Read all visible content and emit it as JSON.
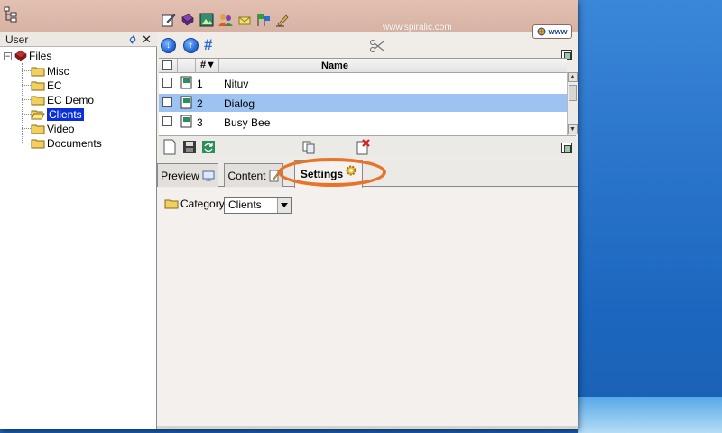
{
  "header": {
    "site_url": "www.spiralic.com",
    "www_button_label": "www"
  },
  "left_panel": {
    "title": "User",
    "tree": {
      "root": "Files",
      "children": [
        "Misc",
        "EC",
        "EC Demo",
        "Clients",
        "Video",
        "Documents"
      ],
      "selected": "Clients"
    }
  },
  "list": {
    "columns": {
      "number": "#▼",
      "name": "Name"
    },
    "rows": [
      {
        "number": "1",
        "name": "Nituv"
      },
      {
        "number": "2",
        "name": "Dialog"
      },
      {
        "number": "3",
        "name": "Busy Bee"
      }
    ],
    "selected_row": "2"
  },
  "tabs": [
    {
      "label": "Preview"
    },
    {
      "label": "Content"
    },
    {
      "label": "Settings"
    }
  ],
  "active_tab": "Settings",
  "settings": {
    "category_label": "Category:",
    "category_value": "Clients"
  },
  "colors": {
    "header_bg": "#d7b2a3",
    "selection_blue": "#0a2fd6",
    "row_highlight": "#9dc3f3",
    "highlight_ring": "#e8742a",
    "desktop_blue": "#2a76c8"
  },
  "icons": {
    "toolbar": [
      "edit-icon",
      "book-icon",
      "image-icon",
      "users-icon",
      "mail-icon",
      "flags-icon",
      "pen-icon"
    ],
    "list_toolbar": [
      "down-arrow-icon",
      "up-arrow-icon",
      "hash-icon",
      "cut-icon",
      "maximize-icon"
    ],
    "detail_toolbar": [
      "new-page-icon",
      "save-icon",
      "refresh-icon",
      "copy-icon",
      "delete-icon",
      "maximize-icon"
    ]
  }
}
